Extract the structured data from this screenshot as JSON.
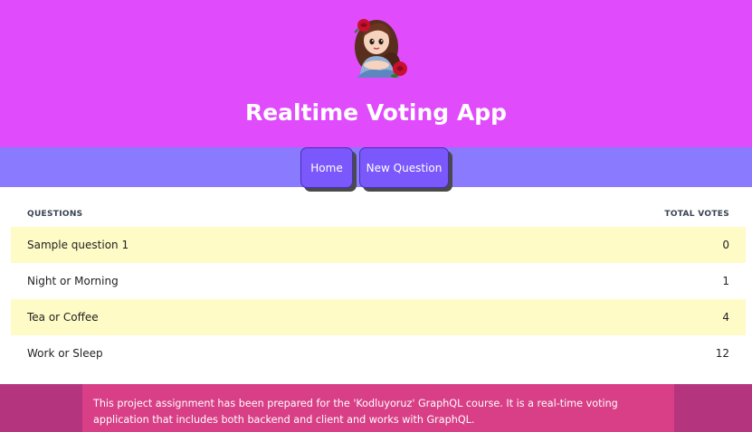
{
  "header": {
    "title": "Realtime Voting App",
    "background": "#e04bfc",
    "logo": "girl-with-rose-avatar"
  },
  "nav": {
    "background": "#8a7afe",
    "button_color": "#7b58fb",
    "home_label": "Home",
    "new_question_label": "New Question"
  },
  "table": {
    "col_questions": "QUESTIONS",
    "col_votes": "TOTAL VOTES",
    "rows": [
      {
        "question": "Sample question 1",
        "votes": "0"
      },
      {
        "question": "Night or Morning",
        "votes": "1"
      },
      {
        "question": "Tea or Coffee",
        "votes": "4"
      },
      {
        "question": "Work or Sleep",
        "votes": "12"
      }
    ],
    "stripe_color": "#fefbc6"
  },
  "footer": {
    "text": "This project assignment has been prepared for the 'Kodluyoruz' GraphQL course. It is a real-time voting application that includes both backend and client and works with GraphQL.",
    "background": "#b4357e",
    "box_color": "#d83f86"
  }
}
